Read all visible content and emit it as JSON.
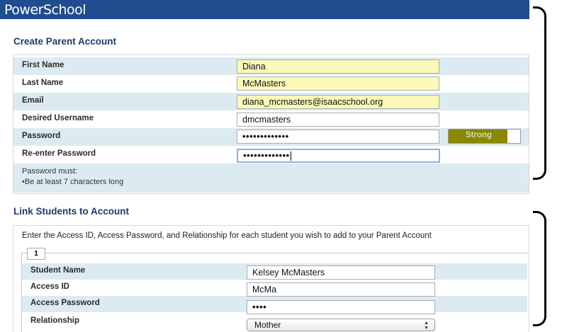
{
  "app": {
    "logo": "PowerSchool"
  },
  "create_account": {
    "heading": "Create Parent Account",
    "fields": [
      {
        "label": "First Name",
        "value": "Diana"
      },
      {
        "label": "Last Name",
        "value": "McMasters"
      },
      {
        "label": "Email",
        "value": "diana_mcmasters@isaacschool.org"
      },
      {
        "label": "Desired Username",
        "value": "dmcmasters"
      },
      {
        "label": "Password",
        "value": "•••••••••••••"
      },
      {
        "label": "Re-enter Password",
        "value": "•••••••••••••"
      }
    ],
    "strength": {
      "label": "Strong",
      "level": 0.82,
      "color": "#8a8700"
    },
    "rules_title": "Password must:",
    "rules": [
      "•Be at least 7 characters long"
    ]
  },
  "link_students": {
    "heading": "Link Students to Account",
    "intro": "Enter the Access ID, Access Password, and Relationship for each student you wish to add to your Parent Account",
    "student_number": "1",
    "fields": [
      {
        "label": "Student Name",
        "value": "Kelsey McMasters"
      },
      {
        "label": "Access ID",
        "value": "McMa"
      },
      {
        "label": "Access Password",
        "value": "••••"
      },
      {
        "label": "Relationship",
        "value": "Mother"
      }
    ]
  },
  "colors": {
    "header": "#1f4d8f",
    "row_shade": "#dcebf1",
    "field_highlight": "#fbf9b8"
  }
}
